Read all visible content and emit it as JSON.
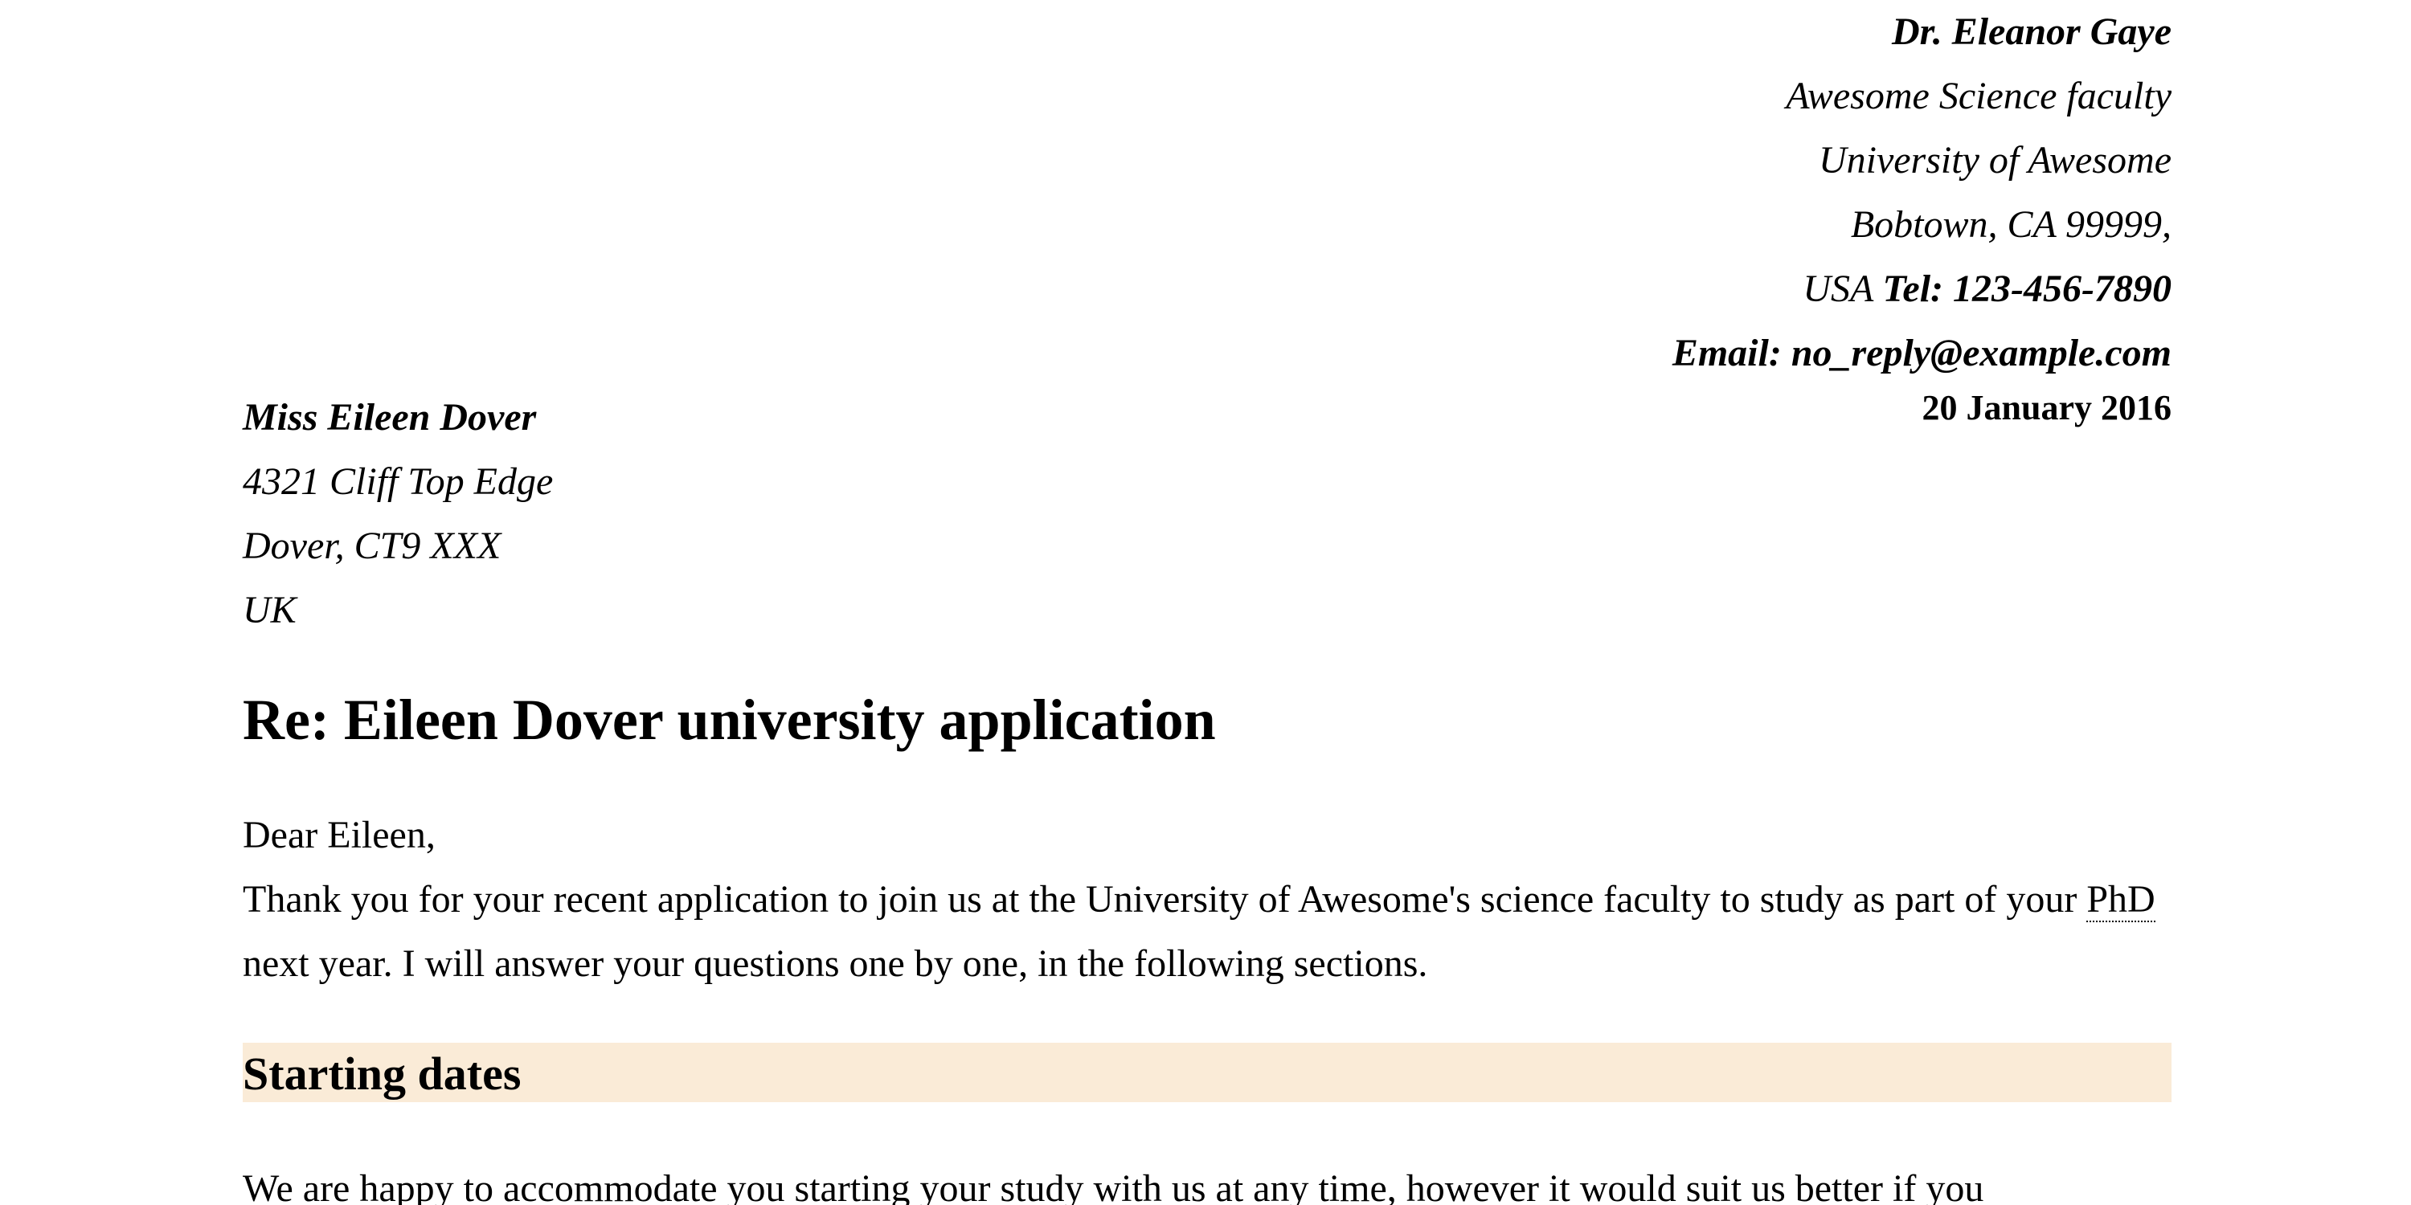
{
  "sender": {
    "name": "Dr. Eleanor Gaye",
    "faculty": "Awesome Science faculty",
    "university": "University of Awesome",
    "city": "Bobtown, CA 99999,",
    "country": "USA",
    "tel": "Tel: 123-456-7890",
    "email": "Email: no_reply@example.com"
  },
  "date": "20 January 2016",
  "recipient": {
    "name": "Miss Eileen Dover",
    "street": "4321 Cliff Top Edge",
    "city": "Dover, CT9 XXX",
    "country": "UK"
  },
  "subject": "Re: Eileen Dover university application",
  "salutation": "Dear Eileen,",
  "intro": {
    "part1": "Thank you for your recent application to join us at the University of Awesome's science faculty to study as part of your ",
    "abbr": "PhD",
    "part2": " next year. I will answer your questions one by one, in the following sections."
  },
  "section": {
    "heading": "Starting dates",
    "paragraph": "We are happy to accommodate you starting your study with us at any time, however it would suit us better if you"
  },
  "colors": {
    "section_heading_bg": "#FAEBD7",
    "text": "#000000",
    "background": "#ffffff"
  }
}
